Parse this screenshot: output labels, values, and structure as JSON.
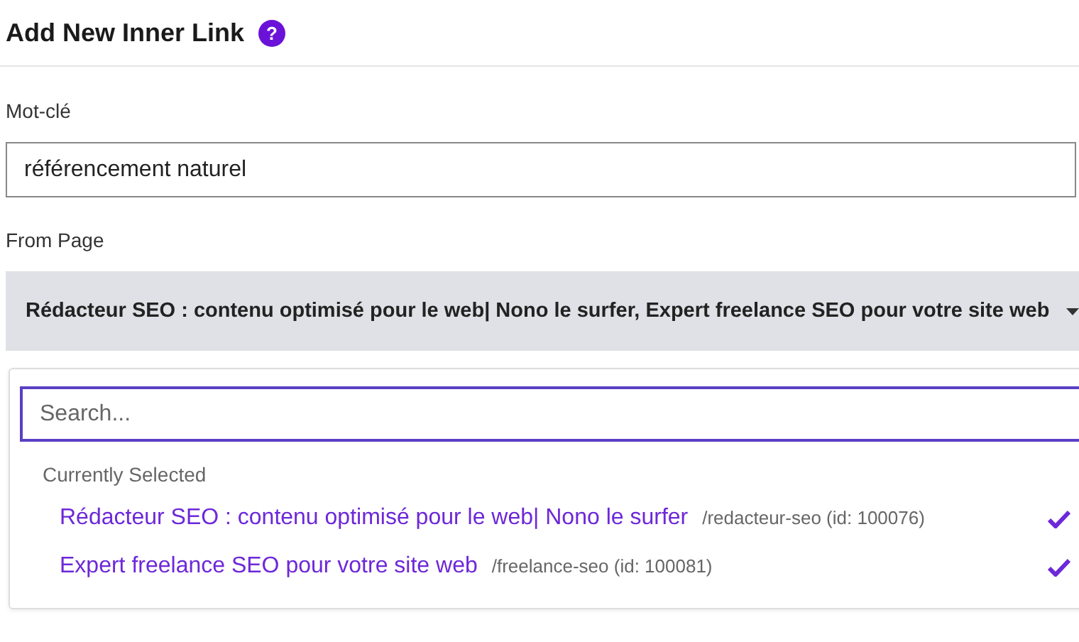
{
  "dialog": {
    "title": "Add New Inner Link",
    "help_icon": "?"
  },
  "keyword": {
    "label": "Mot-clé",
    "value": "référencement naturel"
  },
  "from_page": {
    "label": "From Page",
    "value": "Rédacteur SEO : contenu optimisé pour le web| Nono le surfer, Expert freelance SEO pour votre site web"
  },
  "dropdown": {
    "search_placeholder": "Search...",
    "section": "Currently Selected",
    "options": [
      {
        "title": "Rédacteur SEO : contenu optimisé pour le web| Nono le surfer",
        "path": "/redacteur-seo (id: 100076)",
        "selected": true
      },
      {
        "title": "Expert freelance SEO pour votre site web",
        "path": "/freelance-seo (id: 100081)",
        "selected": true
      }
    ]
  }
}
